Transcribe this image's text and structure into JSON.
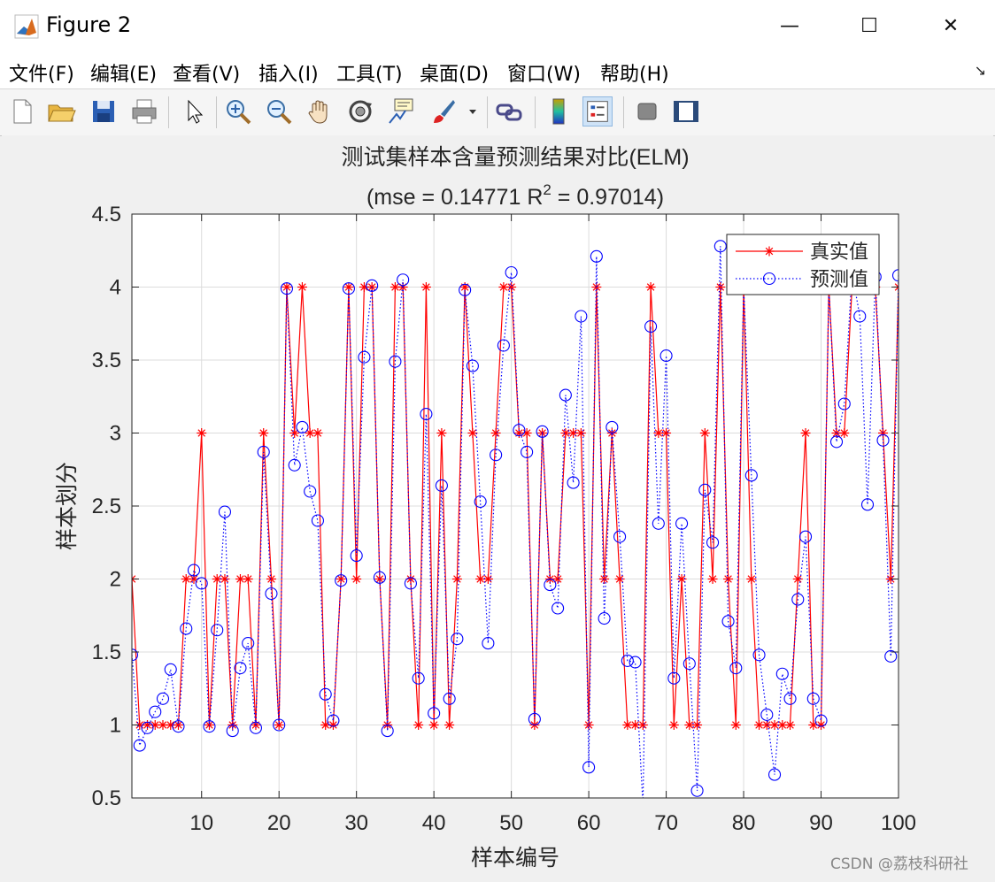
{
  "window": {
    "title": "Figure 2",
    "minimize": "—",
    "maximize": "☐",
    "close": "✕"
  },
  "menu": [
    "文件(F)",
    "编辑(E)",
    "查看(V)",
    "插入(I)",
    "工具(T)",
    "桌面(D)",
    "窗口(W)",
    "帮助(H)"
  ],
  "menu_overflow": "↘",
  "toolbar": [
    "new-file-icon",
    "open-folder-icon",
    "save-icon",
    "print-icon",
    "pointer-icon",
    "zoom-in-icon",
    "zoom-out-icon",
    "pan-icon",
    "rotate-3d-icon",
    "data-cursor-icon",
    "brush-icon",
    "link-plot-icon",
    "colorbar-icon",
    "legend-icon",
    "hide-plot-tools-icon",
    "show-plot-tools-icon"
  ],
  "watermark": "CSDN @荔枝科研社",
  "chart_data": {
    "type": "line",
    "title": "测试集样本含量预测结果对比(ELM)",
    "subtitle_prefix": "(mse = 0.14771 R",
    "subtitle_sup": "2",
    "subtitle_suffix": " = 0.97014)",
    "xlabel": "样本编号",
    "ylabel": "样本划分",
    "xlim": [
      1,
      100
    ],
    "ylim": [
      0.5,
      4.5
    ],
    "xticks": [
      10,
      20,
      30,
      40,
      50,
      60,
      70,
      80,
      90,
      100
    ],
    "yticks": [
      0.5,
      1,
      1.5,
      2,
      2.5,
      3,
      3.5,
      4,
      4.5
    ],
    "grid": true,
    "legend_position": "top-right",
    "series": [
      {
        "name": "真实值",
        "color": "#ff0000",
        "line": "solid",
        "marker": "asterisk",
        "values": [
          2,
          1,
          1,
          1,
          1,
          1,
          1,
          2,
          2,
          3,
          1,
          2,
          2,
          1,
          2,
          2,
          1,
          3,
          2,
          1,
          4,
          3,
          4,
          3,
          3,
          1,
          1,
          2,
          4,
          2,
          4,
          4,
          2,
          1,
          4,
          4,
          2,
          1,
          4,
          1,
          3,
          1,
          2,
          4,
          3,
          2,
          2,
          3,
          4,
          4,
          3,
          3,
          1,
          3,
          2,
          2,
          3,
          3,
          3,
          1,
          4,
          2,
          3,
          2,
          1,
          1,
          1,
          4,
          3,
          3,
          1,
          2,
          1,
          1,
          3,
          2,
          4,
          2,
          1,
          4,
          2,
          1,
          1,
          1,
          1,
          1,
          2,
          3,
          1,
          1,
          4,
          3,
          3,
          4,
          4,
          4,
          4,
          3,
          2,
          4
        ]
      },
      {
        "name": "预测值",
        "color": "#0000ff",
        "line": "dotted",
        "marker": "circle",
        "values": [
          1.48,
          0.86,
          0.98,
          1.09,
          1.18,
          1.38,
          0.99,
          1.66,
          2.06,
          1.97,
          0.99,
          1.65,
          2.46,
          0.96,
          1.39,
          1.56,
          0.98,
          2.87,
          1.9,
          1.0,
          3.99,
          2.78,
          3.04,
          2.6,
          2.4,
          1.21,
          1.03,
          1.99,
          3.99,
          2.16,
          3.52,
          4.01,
          2.01,
          0.96,
          3.49,
          4.05,
          1.97,
          1.32,
          3.13,
          1.08,
          2.64,
          1.18,
          1.59,
          3.98,
          3.46,
          2.53,
          1.56,
          2.85,
          3.6,
          4.1,
          3.02,
          2.87,
          1.04,
          3.01,
          1.96,
          1.8,
          3.26,
          2.66,
          3.8,
          0.71,
          4.21,
          1.73,
          3.04,
          2.29,
          1.44,
          1.43,
          0.45,
          3.73,
          2.38,
          3.53,
          1.32,
          2.38,
          1.42,
          0.55,
          2.61,
          2.25,
          4.28,
          1.71,
          1.39,
          4.0,
          2.71,
          1.48,
          1.07,
          0.66,
          1.35,
          1.18,
          1.86,
          2.29,
          1.18,
          1.03,
          4.0,
          2.94,
          3.2,
          4.1,
          3.8,
          2.51,
          4.07,
          2.95,
          1.47,
          4.08
        ]
      }
    ]
  }
}
